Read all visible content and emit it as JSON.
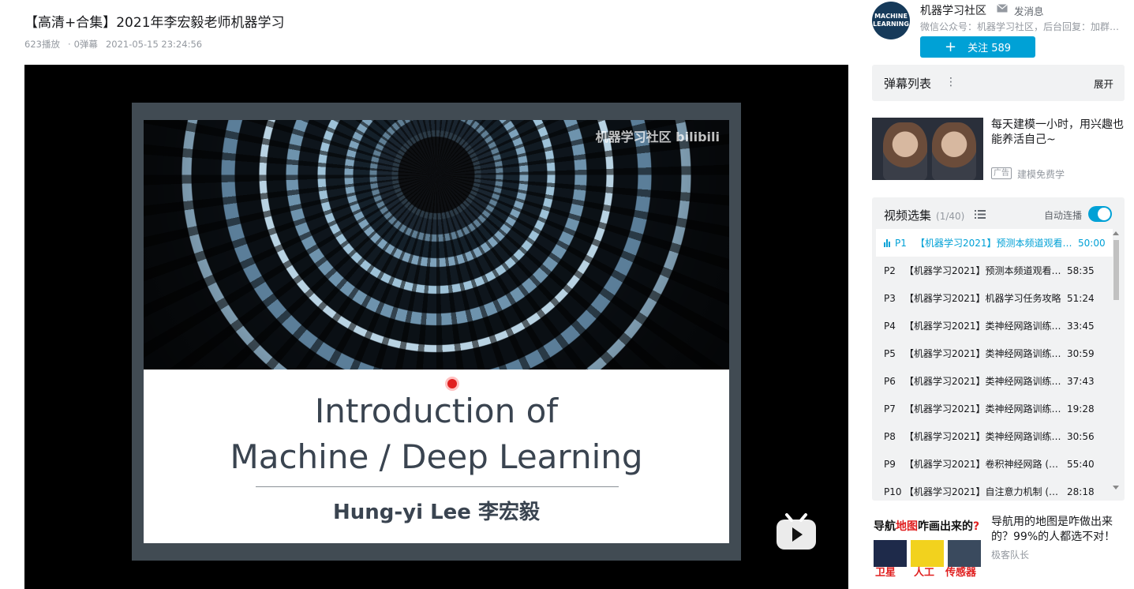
{
  "video": {
    "title": "【高清+合集】2021年李宏毅老师机器学习",
    "plays": "623播放",
    "separator": "·",
    "danmaku_count": "0弹幕",
    "published": "2021-05-15 23:24:56"
  },
  "slide": {
    "watermark": "机器学习社区 bilibili",
    "heading_line1": "Introduction of",
    "heading_line2": "Machine / Deep Learning",
    "author": "Hung-yi Lee 李宏毅"
  },
  "uploader": {
    "avatar_text": "MACHINE LEARNING",
    "name": "机器学习社区",
    "message_label": "发消息",
    "description": "微信公众号：机器学习社区，后台回复：加群…",
    "follow_label": "关注 589",
    "follow_icon": "plus-icon"
  },
  "danmaku_panel": {
    "title": "弹幕列表",
    "menu_glyph": "⋮",
    "expand_label": "展开"
  },
  "ad": {
    "title": "每天建模一小时，用兴趣也能养活自己~",
    "badge": "广告",
    "source": "建模免费学"
  },
  "playlist": {
    "title": "视频选集",
    "count": "(1/40)",
    "autoplay_label": "自动连播",
    "autoplay_on": true,
    "accent_color": "#00a1d6",
    "items": [
      {
        "num": "P1",
        "name": "【机器学习2021】预测本频道观看…",
        "duration": "50:00",
        "active": true
      },
      {
        "num": "P2",
        "name": "【机器学习2021】预测本频道观看人…",
        "duration": "58:35"
      },
      {
        "num": "P3",
        "name": "【机器学习2021】机器学习任务攻略",
        "duration": "51:24"
      },
      {
        "num": "P4",
        "name": "【机器学习2021】类神经网路训练不…",
        "duration": "33:45"
      },
      {
        "num": "P5",
        "name": "【机器学习2021】类神经网路训练不…",
        "duration": "30:59"
      },
      {
        "num": "P6",
        "name": "【机器学习2021】类神经网路训练不…",
        "duration": "37:43"
      },
      {
        "num": "P7",
        "name": "【机器学习2021】类神经网路训练不…",
        "duration": "19:28"
      },
      {
        "num": "P8",
        "name": "【机器学习2021】类神经网路训练不…",
        "duration": "30:56"
      },
      {
        "num": "P9",
        "name": "【机器学习2021】卷积神经网路 (Con…",
        "duration": "55:40"
      },
      {
        "num": "P10",
        "name": "【机器学习2021】自注意力机制 (Sel…",
        "duration": "28:18"
      }
    ]
  },
  "recommendation": {
    "thumb_title_black_1": "导航",
    "thumb_title_red": "地图",
    "thumb_title_black_2": "咋画出来的",
    "thumb_title_red_2": "?",
    "tiles": [
      "卫星",
      "人工",
      "传感器"
    ],
    "title": "导航用的地图是咋做出来的？99%的人都选不对！",
    "source": "极客队长"
  }
}
